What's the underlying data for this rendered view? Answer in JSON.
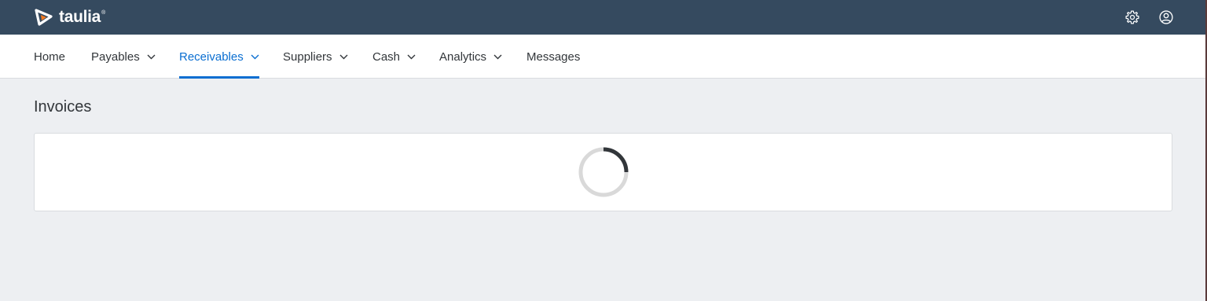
{
  "header": {
    "brand": "taulia",
    "trademark": "®",
    "icons": {
      "settings": "gear-icon",
      "profile": "user-circle-icon"
    },
    "colors": {
      "background": "#354a5f",
      "logo_accent": "#f47a20"
    }
  },
  "nav": {
    "items": [
      {
        "label": "Home",
        "has_dropdown": false,
        "active": false
      },
      {
        "label": "Payables",
        "has_dropdown": true,
        "active": false
      },
      {
        "label": "Receivables",
        "has_dropdown": true,
        "active": true
      },
      {
        "label": "Suppliers",
        "has_dropdown": true,
        "active": false
      },
      {
        "label": "Cash",
        "has_dropdown": true,
        "active": false
      },
      {
        "label": "Analytics",
        "has_dropdown": true,
        "active": false
      },
      {
        "label": "Messages",
        "has_dropdown": false,
        "active": false
      }
    ],
    "active_color": "#0a6ed1"
  },
  "main": {
    "title": "Invoices",
    "loading": true,
    "spinner_icon": "loading-spinner-icon"
  }
}
